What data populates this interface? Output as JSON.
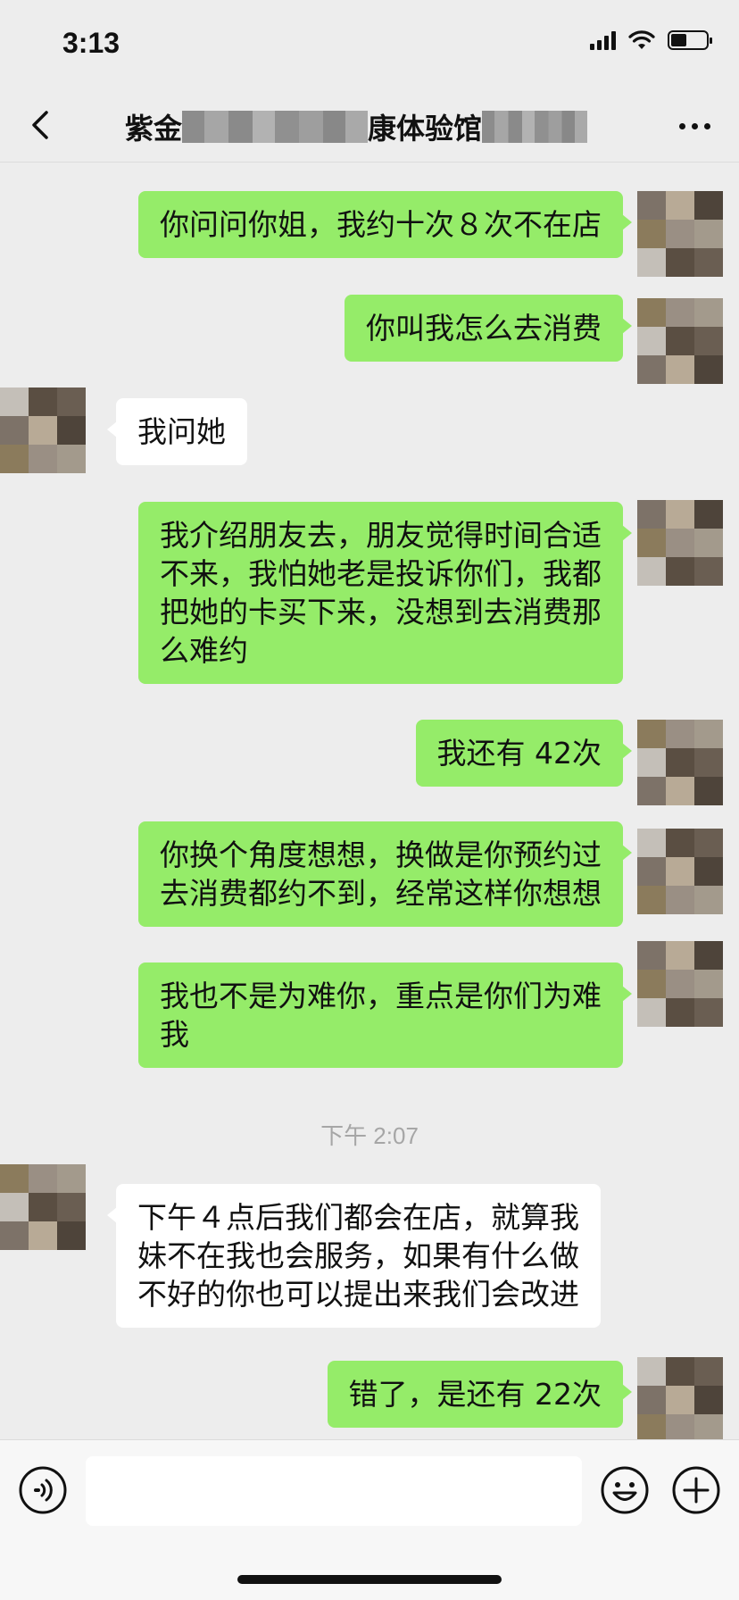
{
  "status": {
    "time": "3:13"
  },
  "header": {
    "title_left": "紫金",
    "title_right": "康体验馆"
  },
  "messages": [
    {
      "side": "right",
      "text": "你问问你姐，我约十次８次不在店"
    },
    {
      "side": "right",
      "text": "你叫我怎么去消费"
    },
    {
      "side": "left",
      "text": "我问她"
    },
    {
      "side": "right",
      "text": "我介绍朋友去，朋友觉得时间合适\n不来，我怕她老是投诉你们，我都\n把她的卡买下来，没想到去消费那\n么难约"
    },
    {
      "side": "right",
      "text": "我还有 42次"
    },
    {
      "side": "right",
      "text": "你换个角度想想，换做是你预约过\n去消费都约不到，经常这样你想想"
    },
    {
      "side": "right",
      "text": "我也不是为难你，重点是你们为难\n我"
    },
    {
      "side": "left",
      "text": "下午４点后我们都会在店，就算我\n妹不在我也会服务，如果有什么做\n不好的你也可以提出来我们会改进"
    },
    {
      "side": "right",
      "text": "错了，是还有 22次"
    }
  ],
  "timestamp": "下午 2:07",
  "colors": {
    "self_bubble": "#95ec69",
    "other_bubble": "#ffffff",
    "background": "#ededed"
  },
  "icons": {
    "back": "chevron-left-icon",
    "more": "more-icon",
    "voice": "voice-icon",
    "emoji": "emoji-icon",
    "plus": "plus-icon"
  }
}
